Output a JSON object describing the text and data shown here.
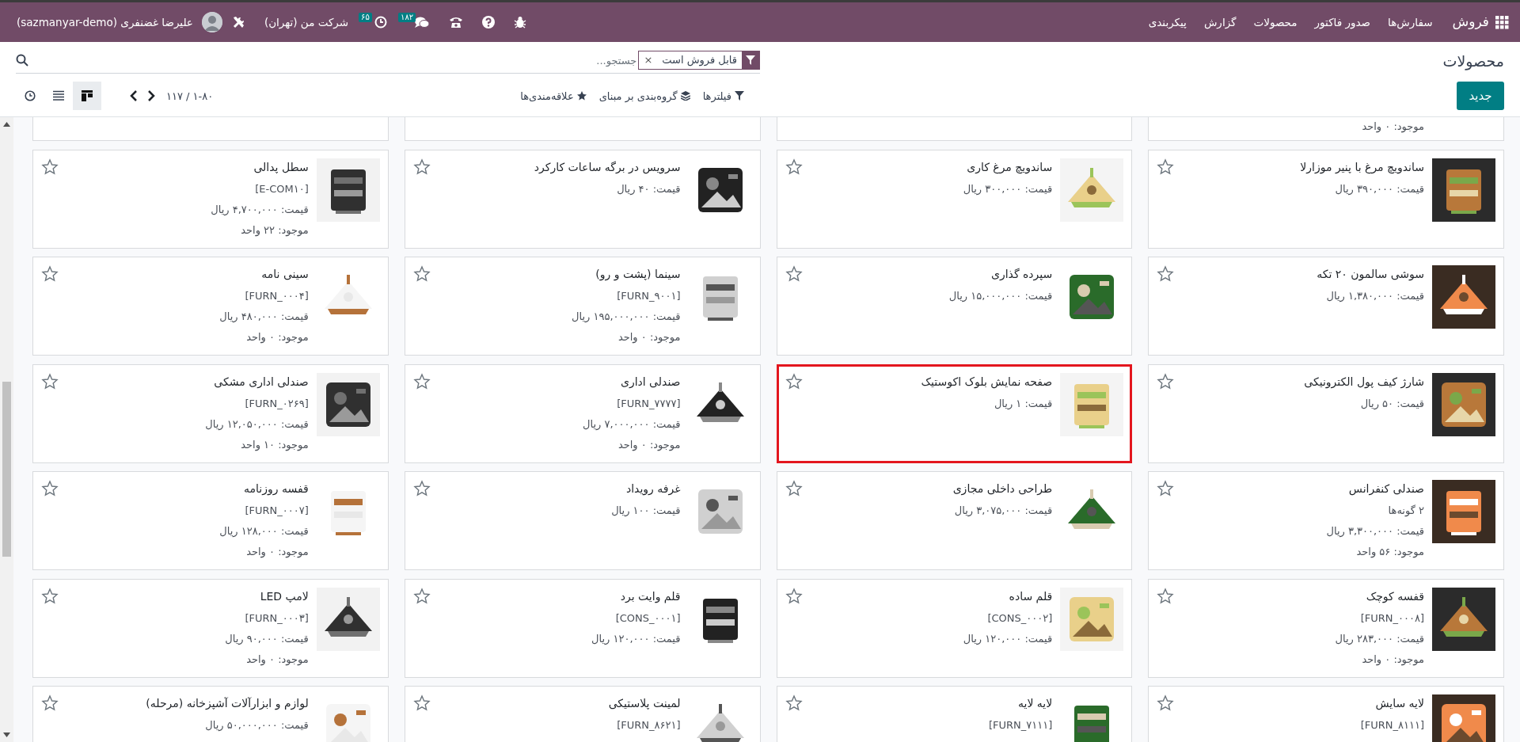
{
  "navbar": {
    "app_name": "فروش",
    "menu": [
      "سفارش‌ها",
      "صدور فاکتور",
      "محصولات",
      "گزارش",
      "پیکربندی"
    ],
    "systray": {
      "chat_count": "۱۸۲",
      "activity_count": "۶۵",
      "company": "شرکت من (تهران)",
      "user": "علیرضا غضنفری (sazmanyar-demo)"
    }
  },
  "control_panel": {
    "title": "محصولات",
    "new_button": "جدید",
    "search": {
      "facets": [
        {
          "label": "قابل فروش است",
          "remove": "×"
        }
      ],
      "placeholder": "جستجو..."
    },
    "actions": [
      {
        "kind": "filter",
        "label": "فیلترها"
      },
      {
        "kind": "group",
        "label": "گروه‌بندی بر مبنای"
      },
      {
        "kind": "favorite",
        "label": "علاقه‌مندی‌ها"
      }
    ],
    "pager": "۱-۸۰ / ۱۱۷",
    "views": [
      {
        "kind": "kanban",
        "selected": true
      },
      {
        "kind": "list",
        "selected": false
      },
      {
        "kind": "activity",
        "selected": false
      }
    ]
  },
  "kanban": {
    "cut_cards": [
      {
        "kind": "stock",
        "stock": "موجود: ۰ واحد"
      },
      {
        "kind": "empty"
      },
      {
        "kind": "empty"
      },
      {
        "kind": "empty"
      }
    ],
    "cards": [
      {
        "name": "ساندویچ مرغ با پنیر موزارلا",
        "price": "قیمت: ۳۹۰,۰۰۰ ریال",
        "favorite": false,
        "highlighted": false
      },
      {
        "name": "ساندویچ مرغ کاری",
        "price": "قیمت: ۳۰۰,۰۰۰ ریال",
        "favorite": false,
        "highlighted": false
      },
      {
        "name": "سرویس در برگه ساعات کارکرد",
        "price": "قیمت: ۴۰ ریال",
        "favorite": false,
        "highlighted": false
      },
      {
        "name": "سطل پدالی",
        "code": "[E-COM۱۰]",
        "price": "قیمت: ۴,۷۰۰,۰۰۰ ریال",
        "stock": "موجود: ۲۲ واحد",
        "favorite": false,
        "highlighted": false
      },
      {
        "name": "سوشی سالمون ۲۰ تکه",
        "price": "قیمت: ۱,۳۸۰,۰۰۰ ریال",
        "favorite": false,
        "highlighted": false
      },
      {
        "name": "سپرده گذاری",
        "price": "قیمت: ۱۵,۰۰۰,۰۰۰ ریال",
        "favorite": false,
        "highlighted": false
      },
      {
        "name": "سینما (پشت و رو)",
        "code": "[FURN_۹۰۰۱]",
        "price": "قیمت: ۱۹۵,۰۰۰,۰۰۰ ریال",
        "stock": "موجود: ۰ واحد",
        "favorite": false,
        "highlighted": false
      },
      {
        "name": "سینی نامه",
        "code": "[FURN_۰۰۰۴]",
        "price": "قیمت: ۴۸۰,۰۰۰ ریال",
        "stock": "موجود: ۰ واحد",
        "favorite": false,
        "highlighted": false
      },
      {
        "name": "شارژ کیف پول الکترونیکی",
        "price": "قیمت: ۵۰ ریال",
        "favorite": false,
        "highlighted": false
      },
      {
        "name": "صفحه نمایش بلوک اکوستیک",
        "price": "قیمت: ۱ ریال",
        "favorite": false,
        "highlighted": true
      },
      {
        "name": "صندلی اداری",
        "code": "[FURN_۷۷۷۷]",
        "price": "قیمت: ۷,۰۰۰,۰۰۰ ریال",
        "stock": "موجود: ۰ واحد",
        "favorite": false,
        "highlighted": false
      },
      {
        "name": "صندلی اداری مشکی",
        "code": "[FURN_۰۲۶۹]",
        "price": "قیمت: ۱۲,۰۵۰,۰۰۰ ریال",
        "stock": "موجود: ۱۰ واحد",
        "favorite": false,
        "highlighted": false
      },
      {
        "name": "صندلی کنفرانس",
        "variants": "۲ گونه‌ها",
        "price": "قیمت: ۳,۳۰۰,۰۰۰ ریال",
        "stock": "موجود: ۵۶ واحد",
        "favorite": false,
        "highlighted": false
      },
      {
        "name": "طراحی داخلی مجازی",
        "price": "قیمت: ۳,۰۷۵,۰۰۰ ریال",
        "favorite": false,
        "highlighted": false
      },
      {
        "name": "غرفه رویداد",
        "price": "قیمت: ۱۰۰ ریال",
        "favorite": false,
        "highlighted": false
      },
      {
        "name": "قفسه روزنامه",
        "code": "[FURN_۰۰۰۷]",
        "price": "قیمت: ۱۲۸,۰۰۰ ریال",
        "stock": "موجود: ۰ واحد",
        "favorite": false,
        "highlighted": false
      },
      {
        "name": "قفسه کوچک",
        "code": "[FURN_۰۰۰۸]",
        "price": "قیمت: ۲۸۳,۰۰۰ ریال",
        "stock": "موجود: ۰ واحد",
        "favorite": false,
        "highlighted": false
      },
      {
        "name": "قلم ساده",
        "code": "[CONS_۰۰۰۲]",
        "price": "قیمت: ۱۲۰,۰۰۰ ریال",
        "favorite": false,
        "highlighted": false
      },
      {
        "name": "قلم وایت برد",
        "code": "[CONS_۰۰۰۱]",
        "price": "قیمت: ۱۲۰,۰۰۰ ریال",
        "favorite": false,
        "highlighted": false
      },
      {
        "name": "لامپ LED",
        "code": "[FURN_۰۰۰۳]",
        "price": "قیمت: ۹۰,۰۰۰ ریال",
        "stock": "موجود: ۰ واحد",
        "favorite": false,
        "highlighted": false
      },
      {
        "name": "لایه سایش",
        "code": "[FURN_۸۱۱۱]",
        "favorite": false,
        "highlighted": false
      },
      {
        "name": "لایه لایه",
        "code": "[FURN_۷۱۱۱]",
        "favorite": false,
        "highlighted": false
      },
      {
        "name": "لمینت پلاستیکی",
        "code": "[FURN_۸۶۲۱]",
        "favorite": false,
        "highlighted": false
      },
      {
        "name": "لوازم و ابزارآلات آشپزخانه (مرحله)",
        "price": "قیمت: ۵۰,۰۰۰,۰۰۰ ریال",
        "favorite": false,
        "highlighted": false
      }
    ]
  }
}
